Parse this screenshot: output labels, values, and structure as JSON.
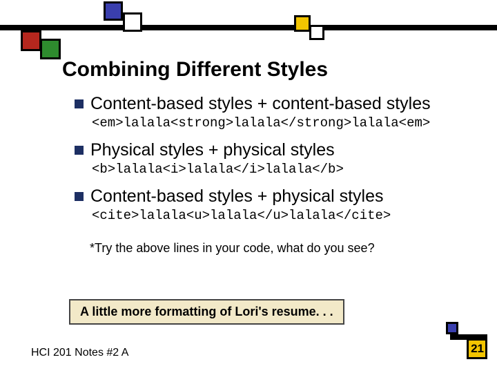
{
  "slide": {
    "title": "Combining Different Styles",
    "bullets": [
      {
        "text": "Content-based styles + content-based styles",
        "code": "<em>lalala<strong>lalala</strong>lalala<em>"
      },
      {
        "text": "Physical styles + physical styles",
        "code": "<b>lalala<i>lalala</i>lalala</b>"
      },
      {
        "text": "Content-based styles + physical styles",
        "code": "<cite>lalala<u>lalala</u>lalala</cite>"
      }
    ],
    "note": "*Try the above lines in your code, what do you see?",
    "ribbon": "A little more formatting of Lori's resume. . .",
    "footer": "HCI 201 Notes #2 A",
    "page_number": "21"
  }
}
